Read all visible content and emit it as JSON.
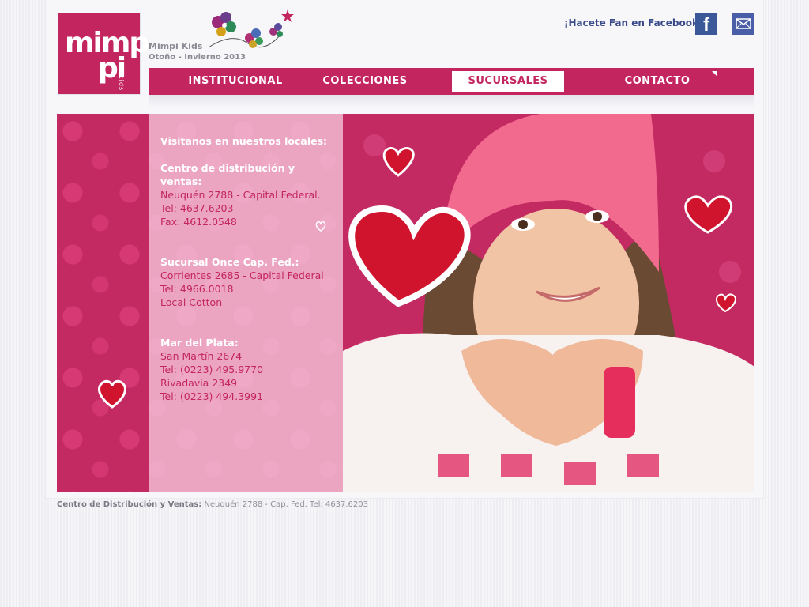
{
  "brand": {
    "logo_line1": "mimp",
    "logo_line2": "pi",
    "logo_kids": "kids",
    "name": "Mimpi Kids",
    "season": "Otoño - Invierno 2013"
  },
  "social": {
    "facebook_text": "¡Hacete Fan en Facebook!",
    "facebook_icon": "facebook-icon",
    "mail_icon": "mail-icon"
  },
  "nav": {
    "items": [
      {
        "label": "INSTITUCIONAL",
        "active": false
      },
      {
        "label": "COLECCIONES",
        "active": false
      },
      {
        "label": "SUCURSALES",
        "active": true
      },
      {
        "label": "CONTACTO",
        "active": false
      }
    ]
  },
  "locations": {
    "intro": "Visitanos en nuestros locales:",
    "blocks": [
      {
        "title": "Centro de distribución y ventas:",
        "lines": [
          "Neuquén 2788 - Capital Federal.",
          "Tel: 4637.6203",
          "Fax: 4612.0548"
        ]
      },
      {
        "title": "Sucursal Once Cap. Fed.:",
        "lines": [
          "Corrientes 2685 - Capital Federal",
          "Tel: 4966.0018",
          "Local Cotton"
        ]
      },
      {
        "title": "Mar del Plata:",
        "lines": [
          "San Martín 2674",
          "Tel: (0223) 495.9770",
          "Rivadavia 2349",
          "Tel: (0223) 494.3991"
        ]
      }
    ]
  },
  "footer": {
    "label": "Centro de Distribución y Ventas:",
    "text": " Neuquén 2788 - Cap. Fed. Tel: 4637.6203"
  },
  "colors": {
    "brand": "#c3255f",
    "facebook": "#3b5998"
  }
}
